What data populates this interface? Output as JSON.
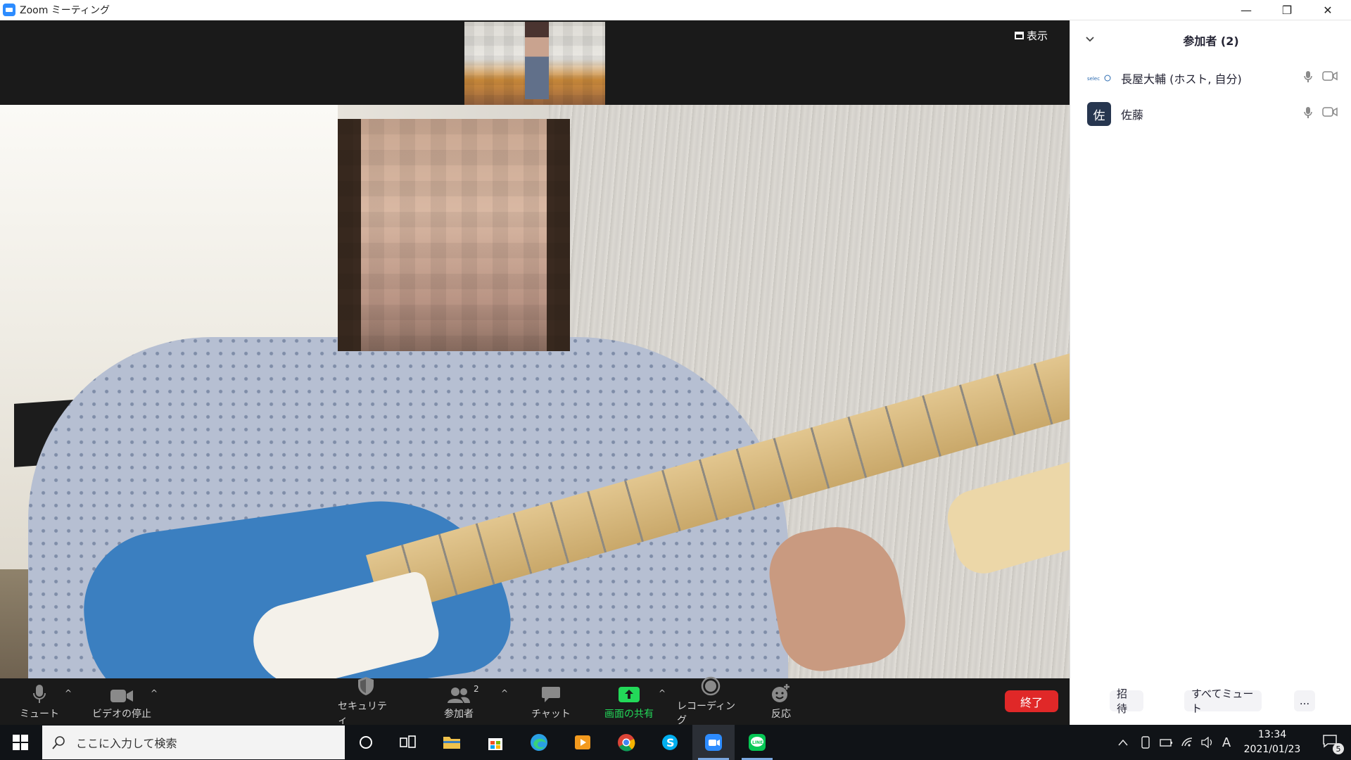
{
  "window": {
    "title": "Zoom ミーティング",
    "controls": {
      "minimize": "—",
      "restore": "❐",
      "close": "✕"
    }
  },
  "video": {
    "view_label": "表示"
  },
  "toolbar": {
    "mute": "ミュート",
    "video_stop": "ビデオの停止",
    "security": "セキュリティ",
    "participants": "参加者",
    "participants_count": "2",
    "chat": "チャット",
    "share_screen": "画面の共有",
    "recording": "レコーディング",
    "reaction": "反応",
    "end": "終了",
    "caret": "^",
    "share_color": "#23d959",
    "end_color": "#e02828"
  },
  "participants_panel": {
    "title": "参加者 (2)",
    "participants": [
      {
        "name": "長屋大輔 (ホスト, 自分)",
        "avatar_icon": "selec-logo-icon"
      },
      {
        "name": "佐藤",
        "avatar_text": "佐",
        "avatar_color": "#27364f"
      }
    ],
    "invite": "招待",
    "mute_all": "すべてミュート",
    "more": "..."
  },
  "taskbar": {
    "search_placeholder": "ここに入力して検索",
    "time": "13:34",
    "date": "2021/01/23",
    "ime": "A",
    "notification_count": "5"
  }
}
